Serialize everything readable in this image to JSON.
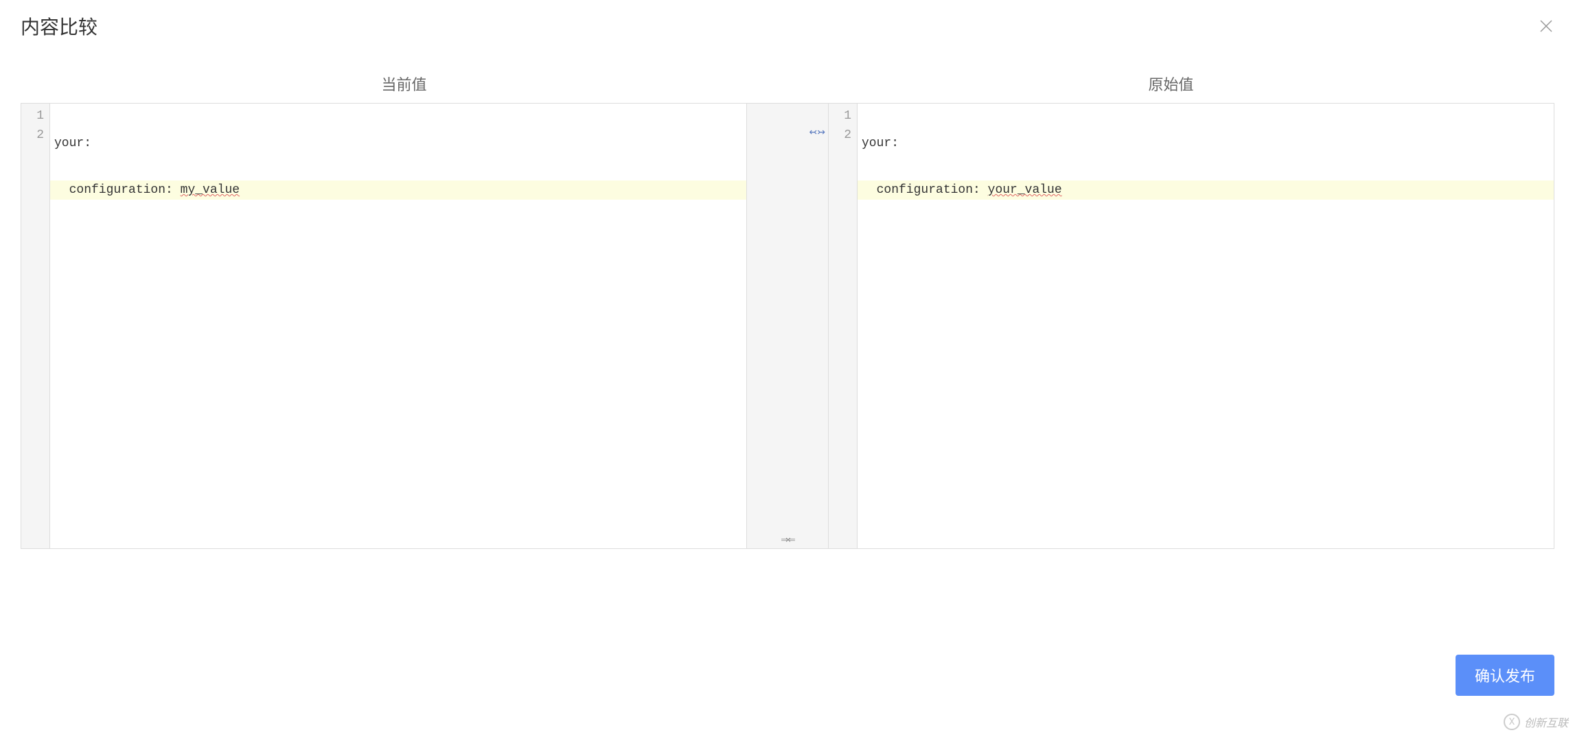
{
  "dialog": {
    "title": "内容比较",
    "close_label": "close"
  },
  "labels": {
    "current": "当前值",
    "original": "原始值"
  },
  "left_editor": {
    "lines": [
      {
        "num": "1",
        "text": "your:",
        "highlight": false
      },
      {
        "num": "2",
        "text": "  configuration: ",
        "highlight": true,
        "value": "my_value",
        "underline_value": true
      }
    ]
  },
  "right_editor": {
    "lines": [
      {
        "num": "1",
        "text": "your:",
        "highlight": false
      },
      {
        "num": "2",
        "text": "  configuration: ",
        "highlight": true,
        "value": "your_value",
        "underline_value": true
      }
    ]
  },
  "connector": {
    "top_marker": "↢↣",
    "bottom_marker": "⇒⇐"
  },
  "footer": {
    "confirm_label": "确认发布"
  },
  "watermark": {
    "text": "创新互联",
    "icon": "X"
  }
}
